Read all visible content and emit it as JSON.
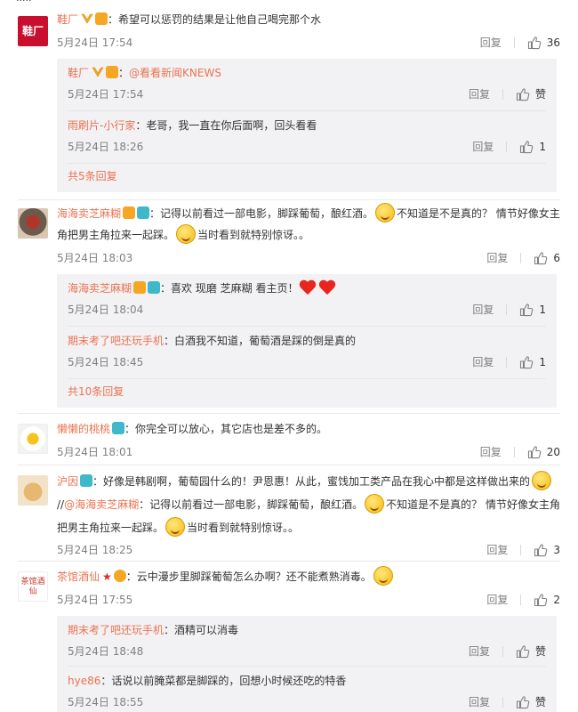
{
  "top_fragment": "·····",
  "comments": [
    {
      "user": "鞋厂",
      "text": "：希望可以惩罚的结果是让他自己喝完那个水",
      "time": "5月24日 17:54",
      "reply_label": "回复",
      "likes": "36",
      "replies": [
        {
          "user": "鞋厂",
          "text": "：",
          "mention": "@看看新闻KNEWS",
          "time": "5月24日 17:54",
          "reply_label": "回复",
          "likes": "赞"
        },
        {
          "user": "雨刷片-小行家",
          "text": "：老哥，我一直在你后面啊，回头看看",
          "time": "5月24日 18:26",
          "reply_label": "回复",
          "likes": "1"
        }
      ],
      "more_label": "共5条回复"
    },
    {
      "user": "海海卖芝麻糊",
      "text_a": "：记得以前看过一部电影，脚踩葡萄，酿红酒。",
      "text_b": "不知道是不是真的？ 情节好像女主角把男主角拉来一起踩。",
      "text_c": "当时看到就特别惊讶。。",
      "time": "5月24日 18:03",
      "reply_label": "回复",
      "likes": "6",
      "replies": [
        {
          "user": "海海卖芝麻糊",
          "text": "：喜欢 现磨 芝麻糊 看主页！",
          "time": "5月24日 18:04",
          "reply_label": "回复",
          "likes": "1"
        },
        {
          "user": "期末考了吧还玩手机",
          "text": "：白酒我不知道，葡萄酒是踩的倒是真的",
          "time": "5月24日 18:45",
          "reply_label": "回复",
          "likes": "1"
        }
      ],
      "more_label": "共10条回复"
    },
    {
      "user": "懒懒的桃桃",
      "text": "：你完全可以放心，其它店也是差不多的。",
      "time": "5月24日 18:01",
      "reply_label": "回复",
      "likes": "20"
    },
    {
      "user": "沪因",
      "text_a": "：好像是韩剧啊，葡萄园什么的！尹恩惠！从此，蜜饯加工类产品在我心中都是这样做",
      "text_b": "出来的",
      "text_c": "//",
      "mention": "@海海卖芝麻糊",
      "text_d": "：记得以前看过一部电影，脚踩葡萄，酿红酒。",
      "text_e": "不知道是不是真",
      "text_f": "的？ 情节好像女主角把男主角拉来一起踩。",
      "text_g": "当时看到就特别惊讶。。",
      "time": "5月24日 18:25",
      "reply_label": "回复",
      "likes": "3"
    },
    {
      "user": "茶馆酒仙",
      "text": "：云中漫步里脚踩葡萄怎么办啊？还不能煮熟消毒。",
      "time": "5月24日 17:55",
      "reply_label": "回复",
      "likes": "2",
      "replies": [
        {
          "user": "期末考了吧还玩手机",
          "text": "：酒精可以消毒",
          "time": "5月24日 18:48",
          "reply_label": "回复",
          "likes": "赞"
        },
        {
          "user": "hye86",
          "text": "：话说以前腌菜都是脚踩的，回想小时候还吃的特香",
          "time": "5月24日 18:55",
          "reply_label": "回复",
          "likes": "赞"
        }
      ]
    }
  ],
  "avatars": {
    "c1": "鞋厂",
    "c5": "茶馆酒仙"
  },
  "colors": {
    "username": "#eb7350",
    "reply_bg": "#f2f2f5",
    "meta": "#808080"
  }
}
